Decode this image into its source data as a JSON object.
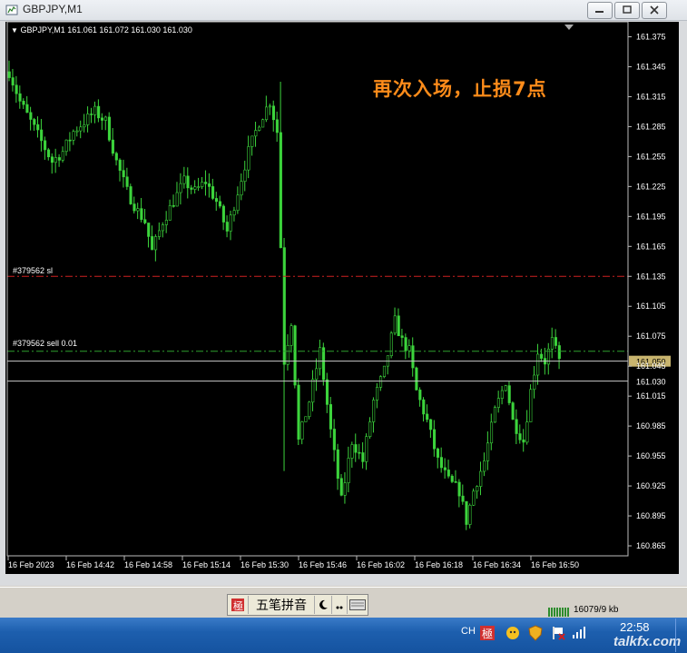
{
  "window": {
    "title": "GBPJPY,M1"
  },
  "chart_header": "GBPJPY,M1  161.061 161.072 161.030 161.030",
  "annotation": "再次入场，止损7点",
  "orders": [
    {
      "label": "#379562 sl",
      "price": 161.135,
      "color": "#cc2020"
    },
    {
      "label": "#379562 sell 0.01",
      "price": 161.06,
      "color": "#2ea02e"
    }
  ],
  "chart_data": {
    "type": "candlestick",
    "symbol": "GBPJPY",
    "timeframe": "M1",
    "ylim": [
      160.855,
      161.39
    ],
    "y_ticks": [
      "161.375",
      "161.345",
      "161.315",
      "161.285",
      "161.255",
      "161.225",
      "161.195",
      "161.165",
      "161.135",
      "161.105",
      "161.075",
      "161.045",
      "161.015",
      "160.985",
      "160.955",
      "160.925",
      "160.895",
      "160.865"
    ],
    "x_ticks": [
      "16 Feb 2023",
      "16 Feb 14:42",
      "16 Feb 14:58",
      "16 Feb 15:14",
      "16 Feb 15:30",
      "16 Feb 15:46",
      "16 Feb 16:02",
      "16 Feb 16:18",
      "16 Feb 16:34",
      "16 Feb 16:50"
    ],
    "bid_price": "161.050",
    "last_price": "161.030",
    "bid_line": 161.05,
    "last_line": 161.03,
    "close_path": [
      [
        0,
        161.34
      ],
      [
        3,
        161.31
      ],
      [
        6,
        161.29
      ],
      [
        9,
        161.27
      ],
      [
        12,
        161.25
      ],
      [
        15,
        161.26
      ],
      [
        18,
        161.28
      ],
      [
        21,
        161.29
      ],
      [
        24,
        161.3
      ],
      [
        27,
        161.29
      ],
      [
        30,
        161.25
      ],
      [
        33,
        161.22
      ],
      [
        36,
        161.2
      ],
      [
        38,
        161.19
      ],
      [
        40,
        161.16
      ],
      [
        43,
        161.19
      ],
      [
        46,
        161.21
      ],
      [
        49,
        161.23
      ],
      [
        52,
        161.22
      ],
      [
        55,
        161.23
      ],
      [
        58,
        161.21
      ],
      [
        61,
        161.18
      ],
      [
        64,
        161.22
      ],
      [
        67,
        161.26
      ],
      [
        70,
        161.29
      ],
      [
        73,
        161.31
      ],
      [
        75,
        161.28
      ],
      [
        77,
        161.05
      ],
      [
        79,
        161.09
      ],
      [
        81,
        160.97
      ],
      [
        84,
        161.01
      ],
      [
        87,
        161.06
      ],
      [
        90,
        160.98
      ],
      [
        93,
        160.91
      ],
      [
        96,
        160.97
      ],
      [
        99,
        160.95
      ],
      [
        102,
        161.01
      ],
      [
        105,
        161.04
      ],
      [
        108,
        161.09
      ],
      [
        110,
        161.07
      ],
      [
        112,
        161.06
      ],
      [
        114,
        161.02
      ],
      [
        117,
        160.99
      ],
      [
        120,
        160.95
      ],
      [
        123,
        160.93
      ],
      [
        126,
        160.92
      ],
      [
        128,
        160.89
      ],
      [
        130,
        160.92
      ],
      [
        133,
        160.95
      ],
      [
        136,
        161.0
      ],
      [
        139,
        161.03
      ],
      [
        141,
        160.99
      ],
      [
        144,
        160.97
      ],
      [
        146,
        161.02
      ],
      [
        148,
        161.06
      ],
      [
        150,
        161.05
      ],
      [
        152,
        161.07
      ],
      [
        154,
        161.05
      ]
    ]
  },
  "ime_bar": {
    "mode_label": "五笔拼音"
  },
  "status": {
    "traffic": "16079/9 kb"
  },
  "taskbar": {
    "lang": "CH",
    "clock": "22:58",
    "watermark": "talkfx.com"
  },
  "colors": {
    "chart_bg": "#000000",
    "candle": "#3cd43c",
    "annotation": "#ff8c1a",
    "bid_box": "#c8b46e"
  }
}
